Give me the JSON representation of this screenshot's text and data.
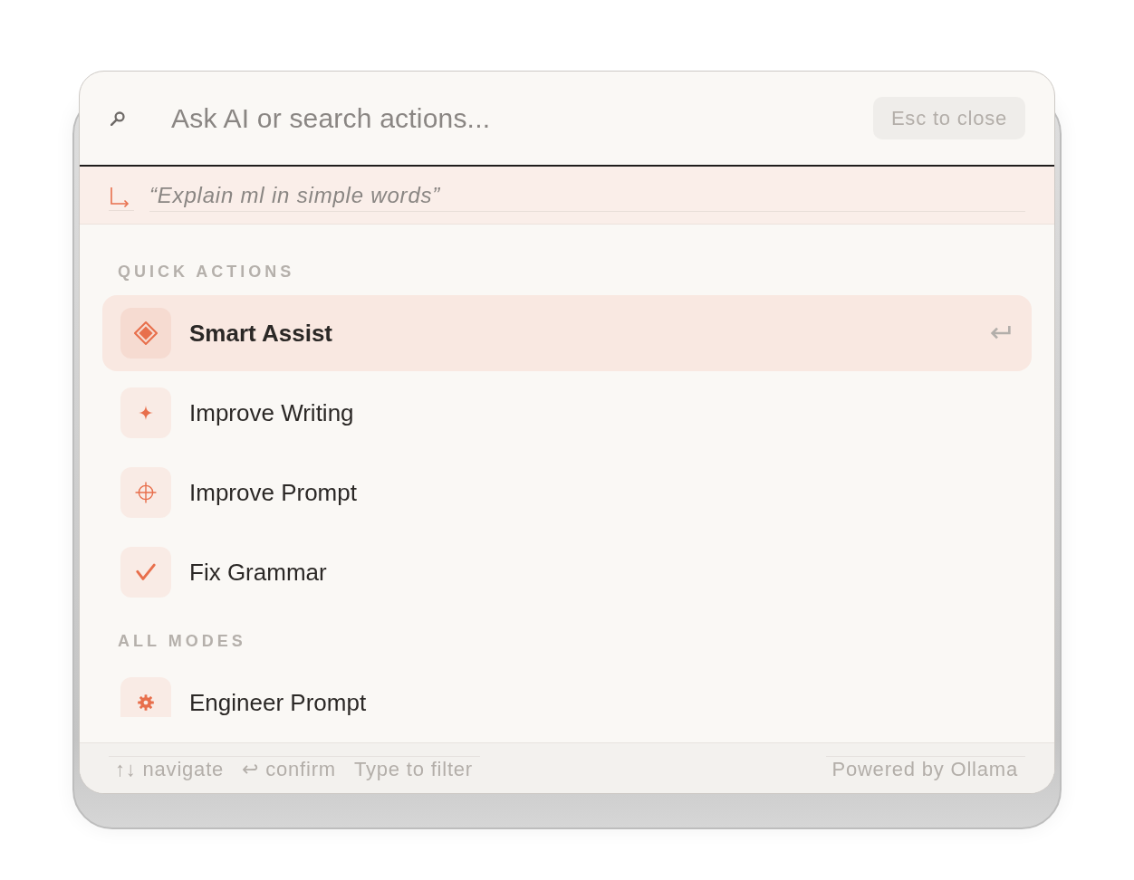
{
  "search": {
    "placeholder": "Ask AI or search actions...",
    "close_hint": "Esc to close"
  },
  "suggestion": {
    "text": "“Explain ml in simple words”"
  },
  "sections": [
    {
      "title": "QUICK ACTIONS",
      "items": [
        {
          "label": "Smart Assist",
          "selected": true
        },
        {
          "label": "Improve Writing",
          "selected": false
        },
        {
          "label": "Improve Prompt",
          "selected": false
        },
        {
          "label": "Fix Grammar",
          "selected": false
        }
      ]
    },
    {
      "title": "ALL MODES",
      "items": [
        {
          "label": "Engineer Prompt",
          "selected": false
        }
      ]
    }
  ],
  "footer": {
    "hints": [
      "↑↓ navigate",
      "↩ confirm",
      "Type to filter"
    ],
    "credit": "Powered by Ollama"
  }
}
